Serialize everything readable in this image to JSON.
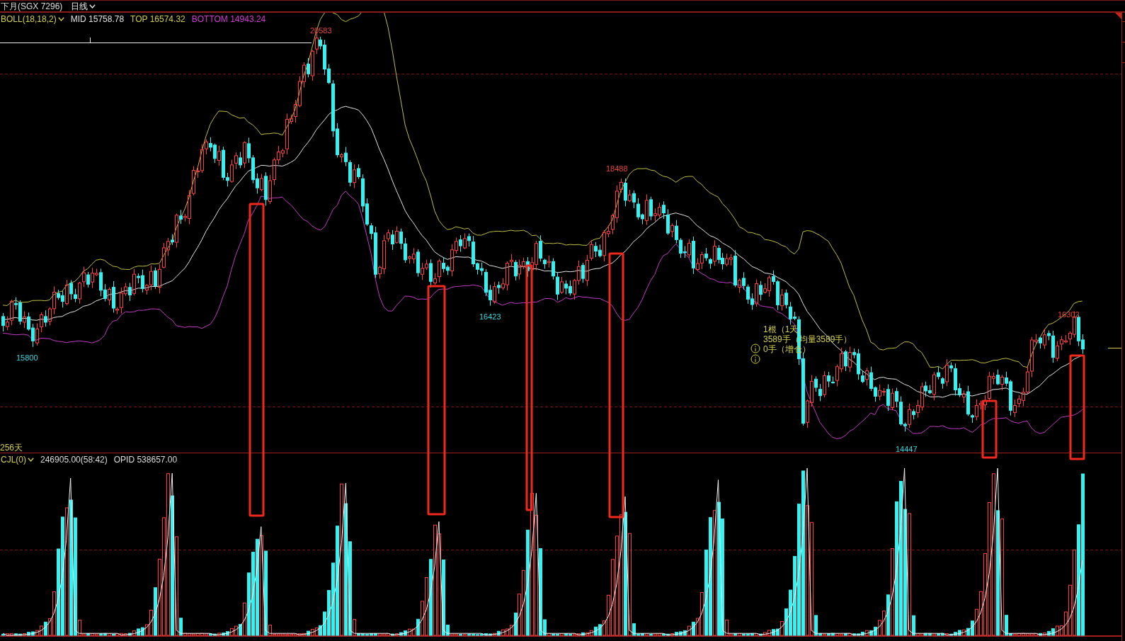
{
  "title_bar": {
    "instrument": "下月(SGX 7296)",
    "period": "日线"
  },
  "price_pane": {
    "indicator": "BOLL(18,18,2)",
    "readings": [
      {
        "kind": "mid",
        "text": "MID 15758.78"
      },
      {
        "kind": "top",
        "text": "TOP 16574.32"
      },
      {
        "kind": "bottom",
        "text": "BOTTOM 14943.24"
      }
    ],
    "price_labels": [
      {
        "kind": "high",
        "text": "20583"
      },
      {
        "kind": "high",
        "text": "18488"
      },
      {
        "kind": "high",
        "text": "16302"
      },
      {
        "kind": "low",
        "text": "16423"
      },
      {
        "kind": "low",
        "text": "15800"
      },
      {
        "kind": "low",
        "text": "14447"
      }
    ],
    "info_lines": [
      "1根（1天）",
      "3589手（均量3589手）",
      "0手（增仓）"
    ],
    "span": "256天"
  },
  "volume_pane": {
    "indicator": "CJL(0)",
    "readings": [
      "246905.00(58:42)",
      "OPID 538657.00"
    ]
  }
}
